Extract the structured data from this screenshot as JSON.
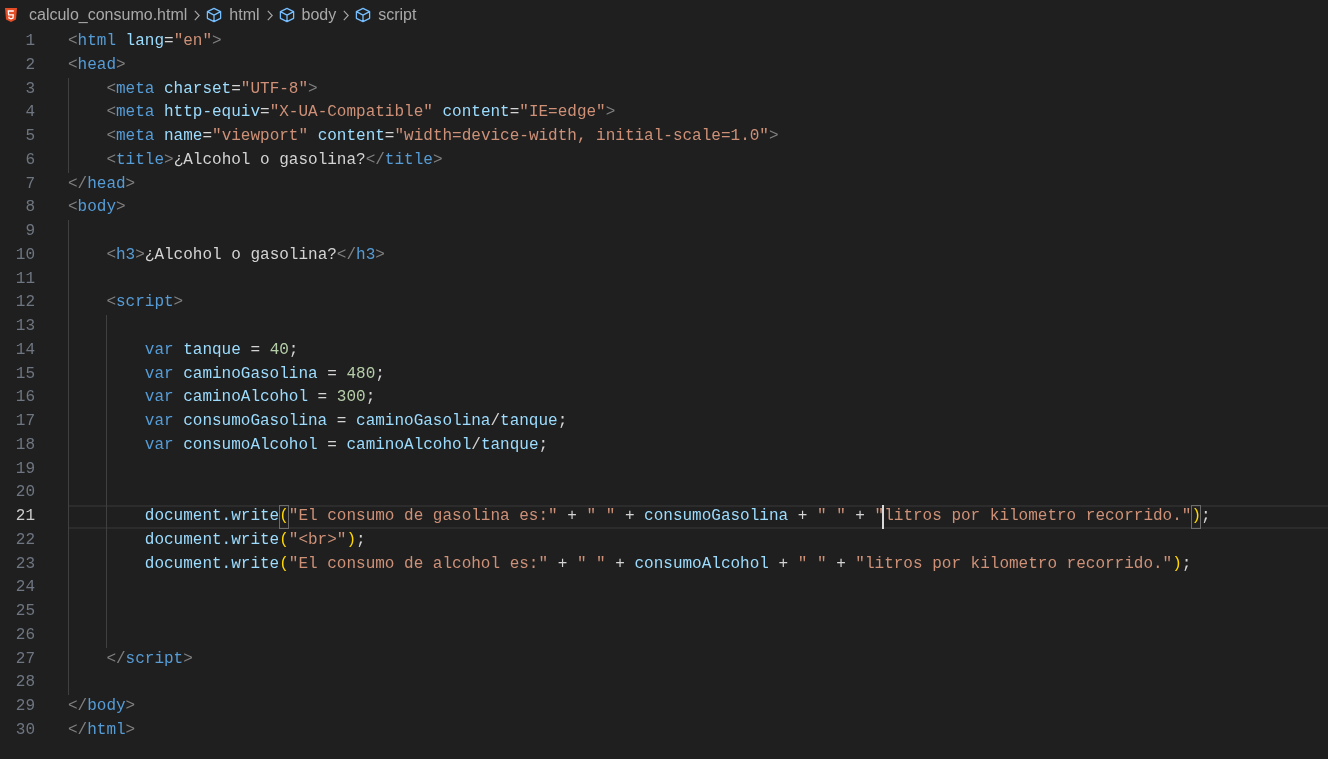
{
  "breadcrumbs": [
    {
      "kind": "file",
      "label": "calculo_consumo.html"
    },
    {
      "kind": "element",
      "label": "html"
    },
    {
      "kind": "element",
      "label": "body"
    },
    {
      "kind": "element",
      "label": "script"
    }
  ],
  "lines": [
    {
      "number": "1",
      "current": false,
      "tokens": [
        {
          "kind": "punct",
          "text": "<"
        },
        {
          "kind": "tag",
          "text": "html"
        },
        {
          "kind": "attr",
          "text": " lang"
        },
        {
          "kind": "op",
          "text": "="
        },
        {
          "kind": "string",
          "text": "\"en\""
        },
        {
          "kind": "punct",
          "text": ">"
        }
      ]
    },
    {
      "number": "2",
      "current": false,
      "tokens": [
        {
          "kind": "punct",
          "text": "<"
        },
        {
          "kind": "tag",
          "text": "head"
        },
        {
          "kind": "punct",
          "text": ">"
        }
      ],
      "children": [
        {
          "number": "3",
          "current": false,
          "tokens": [
            {
              "kind": "punct",
              "text": "<"
            },
            {
              "kind": "tag",
              "text": "meta"
            },
            {
              "kind": "attr",
              "text": " charset"
            },
            {
              "kind": "op",
              "text": "="
            },
            {
              "kind": "string",
              "text": "\"UTF-8\""
            },
            {
              "kind": "punct",
              "text": ">"
            }
          ]
        },
        {
          "number": "4",
          "current": false,
          "tokens": [
            {
              "kind": "punct",
              "text": "<"
            },
            {
              "kind": "tag",
              "text": "meta"
            },
            {
              "kind": "attr",
              "text": " http-equiv"
            },
            {
              "kind": "op",
              "text": "="
            },
            {
              "kind": "string",
              "text": "\"X-UA-Compatible\""
            },
            {
              "kind": "attr",
              "text": " content"
            },
            {
              "kind": "op",
              "text": "="
            },
            {
              "kind": "string",
              "text": "\"IE=edge\""
            },
            {
              "kind": "punct",
              "text": ">"
            }
          ]
        },
        {
          "number": "5",
          "current": false,
          "tokens": [
            {
              "kind": "punct",
              "text": "<"
            },
            {
              "kind": "tag",
              "text": "meta"
            },
            {
              "kind": "attr",
              "text": " name"
            },
            {
              "kind": "op",
              "text": "="
            },
            {
              "kind": "string",
              "text": "\"viewport\""
            },
            {
              "kind": "attr",
              "text": " content"
            },
            {
              "kind": "op",
              "text": "="
            },
            {
              "kind": "string",
              "text": "\"width=device-width, initial-scale=1.0\""
            },
            {
              "kind": "punct",
              "text": ">"
            }
          ]
        },
        {
          "number": "6",
          "current": false,
          "tokens": [
            {
              "kind": "punct",
              "text": "<"
            },
            {
              "kind": "tag",
              "text": "title"
            },
            {
              "kind": "punct",
              "text": ">"
            },
            {
              "kind": "text",
              "text": "¿Alcohol o gasolina?"
            },
            {
              "kind": "punct",
              "text": "</"
            },
            {
              "kind": "tag",
              "text": "title"
            },
            {
              "kind": "punct",
              "text": ">"
            }
          ]
        }
      ]
    },
    {
      "number": "7",
      "current": false,
      "tokens": [
        {
          "kind": "punct",
          "text": "</"
        },
        {
          "kind": "tag",
          "text": "head"
        },
        {
          "kind": "punct",
          "text": ">"
        }
      ]
    },
    {
      "number": "8",
      "current": false,
      "tokens": [
        {
          "kind": "punct",
          "text": "<"
        },
        {
          "kind": "tag",
          "text": "body"
        },
        {
          "kind": "punct",
          "text": ">"
        }
      ],
      "children": [
        {
          "number": "9",
          "current": false
        },
        {
          "number": "10",
          "current": false,
          "tokens": [
            {
              "kind": "punct",
              "text": "<"
            },
            {
              "kind": "tag",
              "text": "h3"
            },
            {
              "kind": "punct",
              "text": ">"
            },
            {
              "kind": "text",
              "text": "¿Alcohol o gasolina?"
            },
            {
              "kind": "punct",
              "text": "</"
            },
            {
              "kind": "tag",
              "text": "h3"
            },
            {
              "kind": "punct",
              "text": ">"
            }
          ]
        },
        {
          "number": "11",
          "current": false
        },
        {
          "number": "12",
          "current": false,
          "tokens": [
            {
              "kind": "punct",
              "text": "<"
            },
            {
              "kind": "tag",
              "text": "script"
            },
            {
              "kind": "punct",
              "text": ">"
            }
          ],
          "children": [
            {
              "number": "13",
              "current": false
            },
            {
              "number": "14",
              "current": false,
              "tokens": [
                {
                  "kind": "keyword",
                  "text": "var"
                },
                {
                  "kind": "variable",
                  "text": " tanque"
                },
                {
                  "kind": "op",
                  "text": " = "
                },
                {
                  "kind": "number",
                  "text": "40"
                },
                {
                  "kind": "op",
                  "text": ";"
                }
              ]
            },
            {
              "number": "15",
              "current": false,
              "tokens": [
                {
                  "kind": "keyword",
                  "text": "var"
                },
                {
                  "kind": "variable",
                  "text": " caminoGasolina"
                },
                {
                  "kind": "op",
                  "text": " = "
                },
                {
                  "kind": "number",
                  "text": "480"
                },
                {
                  "kind": "op",
                  "text": ";"
                }
              ]
            },
            {
              "number": "16",
              "current": false,
              "tokens": [
                {
                  "kind": "keyword",
                  "text": "var"
                },
                {
                  "kind": "variable",
                  "text": " caminoAlcohol"
                },
                {
                  "kind": "op",
                  "text": " = "
                },
                {
                  "kind": "number",
                  "text": "300"
                },
                {
                  "kind": "op",
                  "text": ";"
                }
              ]
            },
            {
              "number": "17",
              "current": false,
              "tokens": [
                {
                  "kind": "keyword",
                  "text": "var"
                },
                {
                  "kind": "variable",
                  "text": " consumoGasolina"
                },
                {
                  "kind": "op",
                  "text": " = "
                },
                {
                  "kind": "variable",
                  "text": "caminoGasolina"
                },
                {
                  "kind": "op",
                  "text": "/"
                },
                {
                  "kind": "variable",
                  "text": "tanque"
                },
                {
                  "kind": "op",
                  "text": ";"
                }
              ]
            },
            {
              "number": "18",
              "current": false,
              "tokens": [
                {
                  "kind": "keyword",
                  "text": "var"
                },
                {
                  "kind": "variable",
                  "text": " consumoAlcohol"
                },
                {
                  "kind": "op",
                  "text": " = "
                },
                {
                  "kind": "variable",
                  "text": "caminoAlcohol"
                },
                {
                  "kind": "op",
                  "text": "/"
                },
                {
                  "kind": "variable",
                  "text": "tanque"
                },
                {
                  "kind": "op",
                  "text": ";"
                }
              ]
            },
            {
              "number": "19",
              "current": false
            },
            {
              "number": "20",
              "current": false
            },
            {
              "number": "21",
              "current": true,
              "tokens": [
                {
                  "kind": "variable",
                  "text": "document.write",
                  "caret": false,
                  "matched": false
                },
                {
                  "kind": "bracket",
                  "text": "(",
                  "caret": false,
                  "matched": true
                },
                {
                  "kind": "string",
                  "text": "\"El consumo de gasolina es:\"",
                  "caret": false,
                  "matched": false
                },
                {
                  "kind": "op",
                  "text": " + ",
                  "caret": false,
                  "matched": false
                },
                {
                  "kind": "string",
                  "text": "\" \"",
                  "caret": false,
                  "matched": false
                },
                {
                  "kind": "op",
                  "text": " + ",
                  "caret": false,
                  "matched": false
                },
                {
                  "kind": "variable",
                  "text": "consumoGasolina",
                  "caret": false,
                  "matched": false
                },
                {
                  "kind": "op",
                  "text": " + ",
                  "caret": false,
                  "matched": false
                },
                {
                  "kind": "string",
                  "text": "\" \"",
                  "caret": false,
                  "matched": false
                },
                {
                  "kind": "op",
                  "text": " + ",
                  "caret": false,
                  "matched": false
                },
                {
                  "kind": "string",
                  "text": "\"",
                  "caret": false,
                  "matched": false
                },
                {
                  "kind": "string",
                  "text": "litros por kilometro recorrido.\"",
                  "caret": true,
                  "matched": false
                },
                {
                  "kind": "bracket",
                  "text": ")",
                  "caret": false,
                  "matched": true
                },
                {
                  "kind": "op",
                  "text": ";",
                  "caret": false,
                  "matched": false
                }
              ]
            },
            {
              "number": "22",
              "current": false,
              "tokens": [
                {
                  "kind": "variable",
                  "text": "document.write"
                },
                {
                  "kind": "bracket",
                  "text": "("
                },
                {
                  "kind": "string",
                  "text": "\"<br>\""
                },
                {
                  "kind": "bracket",
                  "text": ")"
                },
                {
                  "kind": "op",
                  "text": ";"
                }
              ]
            },
            {
              "number": "23",
              "current": false,
              "tokens": [
                {
                  "kind": "variable",
                  "text": "document.write"
                },
                {
                  "kind": "bracket",
                  "text": "("
                },
                {
                  "kind": "string",
                  "text": "\"El consumo de alcohol es:\""
                },
                {
                  "kind": "op",
                  "text": " + "
                },
                {
                  "kind": "string",
                  "text": "\" \""
                },
                {
                  "kind": "op",
                  "text": " + "
                },
                {
                  "kind": "variable",
                  "text": "consumoAlcohol"
                },
                {
                  "kind": "op",
                  "text": " + "
                },
                {
                  "kind": "string",
                  "text": "\" \""
                },
                {
                  "kind": "op",
                  "text": " + "
                },
                {
                  "kind": "string",
                  "text": "\"litros por kilometro recorrido.\""
                },
                {
                  "kind": "bracket",
                  "text": ")"
                },
                {
                  "kind": "op",
                  "text": ";"
                }
              ]
            },
            {
              "number": "24",
              "current": false
            },
            {
              "number": "25",
              "current": false
            },
            {
              "number": "26",
              "current": false
            }
          ]
        },
        {
          "number": "27",
          "current": false,
          "tokens": [
            {
              "kind": "punct",
              "text": "</"
            },
            {
              "kind": "tag",
              "text": "script"
            },
            {
              "kind": "punct",
              "text": ">"
            }
          ]
        },
        {
          "number": "28",
          "current": false
        }
      ]
    },
    {
      "number": "29",
      "current": false,
      "tokens": [
        {
          "kind": "punct",
          "text": "</"
        },
        {
          "kind": "tag",
          "text": "body"
        },
        {
          "kind": "punct",
          "text": ">"
        }
      ]
    },
    {
      "number": "30",
      "current": false,
      "tokens": [
        {
          "kind": "punct",
          "text": "</"
        },
        {
          "kind": "tag",
          "text": "html"
        },
        {
          "kind": "punct",
          "text": ">"
        }
      ]
    }
  ]
}
